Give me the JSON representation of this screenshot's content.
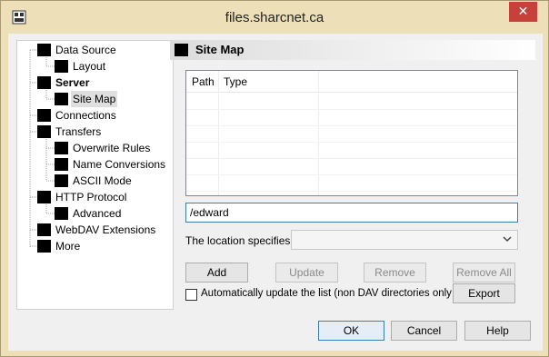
{
  "window": {
    "title": "files.sharcnet.ca",
    "close_glyph": "✕"
  },
  "tree": {
    "items": [
      {
        "label": "Data Source"
      },
      {
        "label": "Layout"
      },
      {
        "label": "Server"
      },
      {
        "label": "Site Map"
      },
      {
        "label": "Connections"
      },
      {
        "label": "Transfers"
      },
      {
        "label": "Overwrite Rules"
      },
      {
        "label": "Name Conversions"
      },
      {
        "label": "ASCII Mode"
      },
      {
        "label": "HTTP Protocol"
      },
      {
        "label": "Advanced"
      },
      {
        "label": "WebDAV Extensions"
      },
      {
        "label": "More"
      }
    ]
  },
  "panel": {
    "title": "Site Map",
    "list": {
      "columns": [
        "Path",
        "Type"
      ],
      "rows": []
    },
    "path_value": "/edward",
    "location_label": "The location specifies:",
    "location_value": "",
    "buttons": {
      "add": "Add",
      "update": "Update",
      "remove": "Remove",
      "remove_all": "Remove All",
      "export": "Export"
    },
    "auto_update_label": "Automatically update the list (non DAV directories only ).",
    "auto_update_checked": false
  },
  "footer": {
    "ok": "OK",
    "cancel": "Cancel",
    "help": "Help"
  }
}
